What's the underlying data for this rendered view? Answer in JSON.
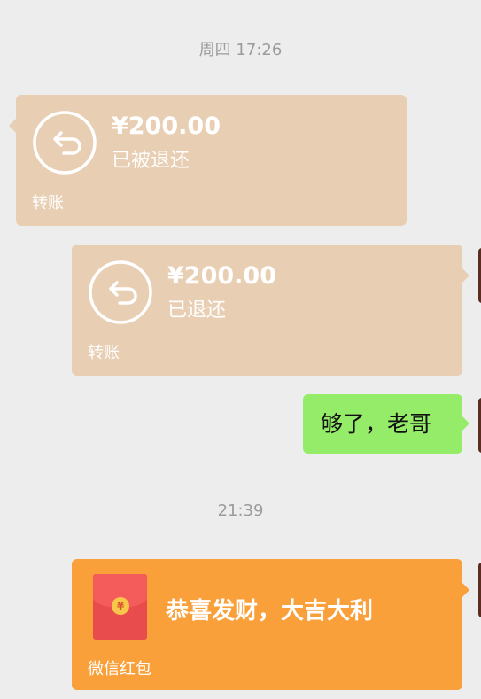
{
  "timestamps": [
    "周四 17:26",
    "21:39"
  ],
  "messages": [
    {
      "type": "transfer",
      "side": "left",
      "amount": "¥200.00",
      "status": "已被退还",
      "footer": "转账",
      "icon": "refund-arrow-icon"
    },
    {
      "type": "transfer",
      "side": "right",
      "amount": "¥200.00",
      "status": "已退还",
      "footer": "转账",
      "icon": "refund-arrow-icon"
    },
    {
      "type": "text",
      "side": "right",
      "text": "够了，老哥"
    },
    {
      "type": "red_packet",
      "side": "right",
      "title": "恭喜发财，大吉大利",
      "footer": "微信红包",
      "icon": "red-envelope-icon",
      "coin_symbol": "¥"
    }
  ],
  "colors": {
    "background": "#ededed",
    "transfer_card": "#e8cfb4",
    "text_bubble": "#95ec69",
    "red_packet": "#f9a03b"
  }
}
